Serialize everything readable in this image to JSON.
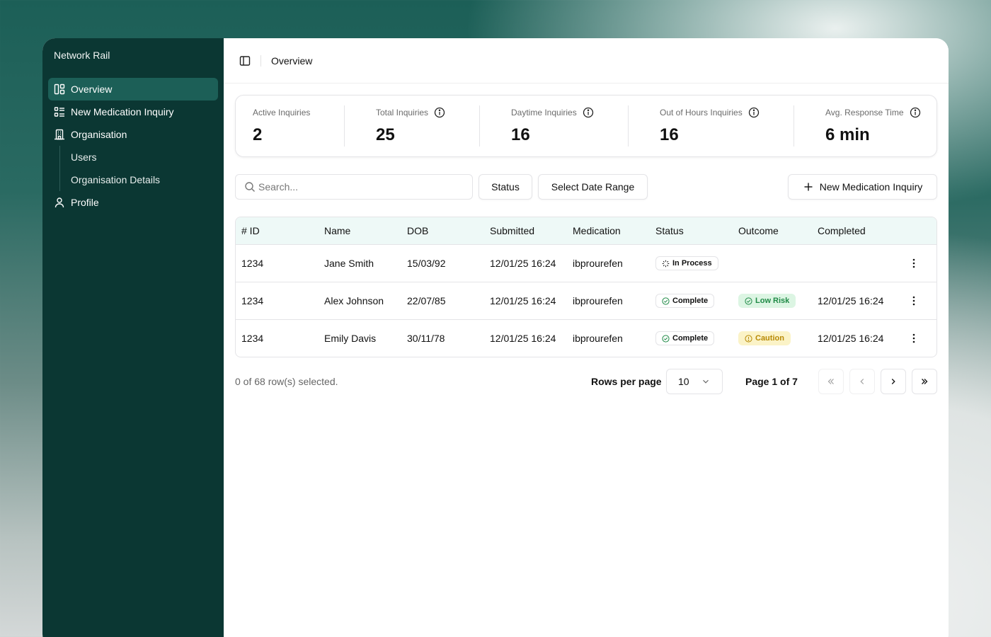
{
  "sidebar": {
    "brand": "Network Rail",
    "items": [
      {
        "label": "Overview",
        "icon": "dashboard-icon",
        "active": true
      },
      {
        "label": "New Medication Inquiry",
        "icon": "list-icon"
      },
      {
        "label": "Organisation",
        "icon": "building-icon"
      },
      {
        "label": "Users"
      },
      {
        "label": "Organisation Details"
      },
      {
        "label": "Profile",
        "icon": "user-icon"
      }
    ]
  },
  "header": {
    "breadcrumb": "Overview"
  },
  "stats": [
    {
      "label": "Active Inquiries",
      "value": "2",
      "info": false
    },
    {
      "label": "Total Inquiries",
      "value": "25",
      "info": true
    },
    {
      "label": "Daytime Inquiries",
      "value": "16",
      "info": true
    },
    {
      "label": "Out of Hours Inquiries",
      "value": "16",
      "info": true
    },
    {
      "label": "Avg. Response Time",
      "value": "6 min",
      "info": true
    }
  ],
  "toolbar": {
    "search_placeholder": "Search...",
    "status_label": "Status",
    "date_range_label": "Select Date Range",
    "new_inquiry_label": "New Medication Inquiry"
  },
  "table": {
    "columns": [
      "# ID",
      "Name",
      "DOB",
      "Submitted",
      "Medication",
      "Status",
      "Outcome",
      "Completed"
    ],
    "rows": [
      {
        "id": "1234",
        "name": "Jane Smith",
        "dob": "15/03/92",
        "submitted": "12/01/25 16:24",
        "medication": "ibprourefen",
        "status": "In Process",
        "outcome": "",
        "completed": ""
      },
      {
        "id": "1234",
        "name": "Alex Johnson",
        "dob": "22/07/85",
        "submitted": "12/01/25 16:24",
        "medication": "ibprourefen",
        "status": "Complete",
        "outcome": "Low Risk",
        "completed": "12/01/25 16:24"
      },
      {
        "id": "1234",
        "name": "Emily Davis",
        "dob": "30/11/78",
        "submitted": "12/01/25 16:24",
        "medication": "ibprourefen",
        "status": "Complete",
        "outcome": "Caution",
        "completed": "12/01/25 16:24"
      }
    ]
  },
  "footer": {
    "selection": "0 of 68 row(s) selected.",
    "rows_per_page_label": "Rows per page",
    "rows_per_page_value": "10",
    "page_label": "Page 1 of 7"
  },
  "colors": {
    "sidebar_bg": "#0b3733",
    "sidebar_active": "#1c5f57",
    "table_header_bg": "#eef9f7",
    "low_risk": "#1f8a46",
    "caution": "#b88a06"
  }
}
